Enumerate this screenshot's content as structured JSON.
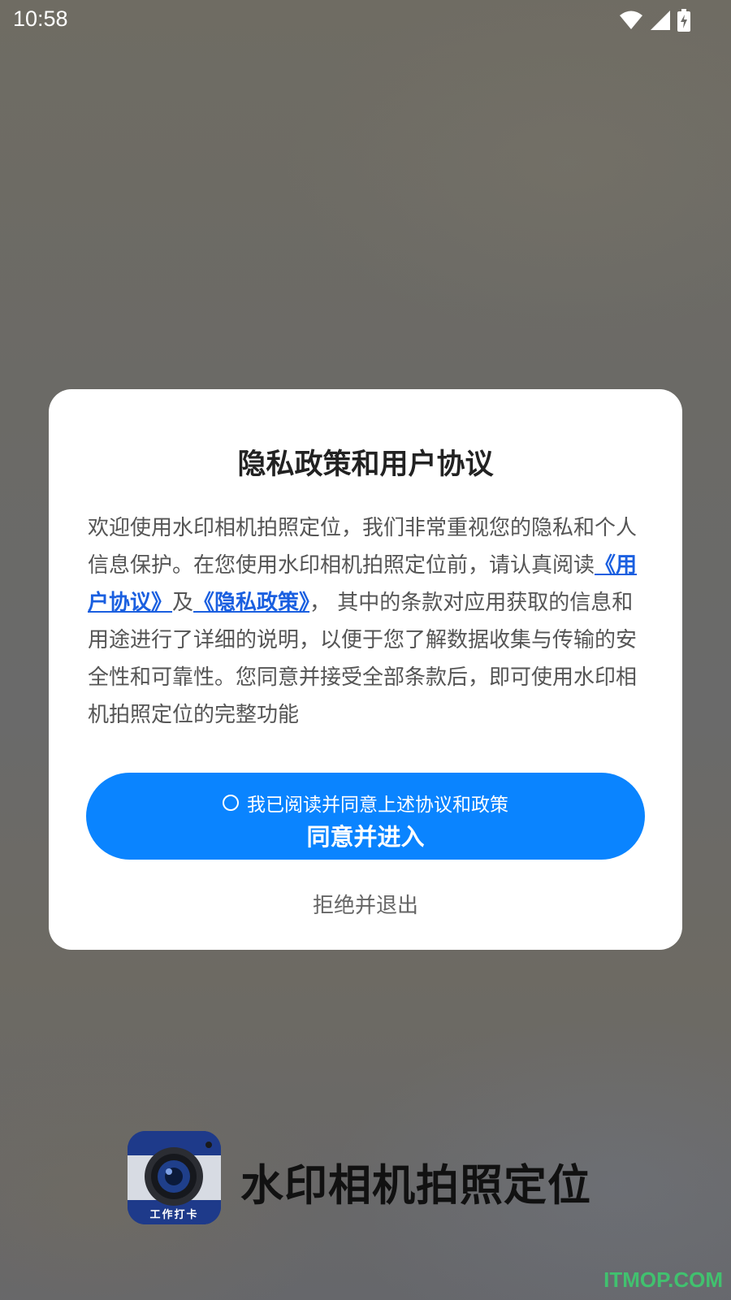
{
  "status_bar": {
    "time": "10:58"
  },
  "dialog": {
    "title": "隐私政策和用户协议",
    "body": {
      "part1": "欢迎使用水印相机拍照定位，我们非常重视您的隐私和个人信息保护。在您使用水印相机拍照定位前，请认真阅读",
      "user_agreement_link": "《用户协议》",
      "and": "及",
      "privacy_policy_link": "《隐私政策》",
      "part2": "， 其中的条款对应用获取的信息和用途进行了详细的说明，以便于您了解数据收集与传输的安全性和可靠性。您同意并接受全部条款后，即可使用水印相机拍照定位的完整功能"
    },
    "agree_checkbox_label": "我已阅读并同意上述协议和政策",
    "agree_checked": false,
    "primary_button_label": "同意并进入",
    "reject_button_label": "拒绝并退出"
  },
  "footer": {
    "app_name": "水印相机拍照定位",
    "logo_text": "工作打卡"
  },
  "watermark": "ITMOP.COM",
  "colors": {
    "primary": "#0a84ff",
    "link": "#1a5fe0",
    "watermark": "#3bd16f"
  },
  "icons": [
    "wifi-icon",
    "cellular-signal-icon",
    "battery-charging-icon",
    "radio-unchecked-icon",
    "camera-app-icon"
  ]
}
